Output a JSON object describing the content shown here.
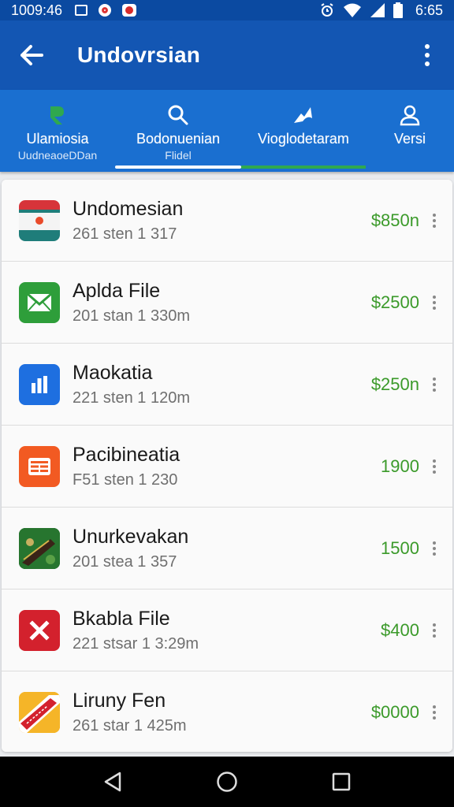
{
  "status_bar": {
    "time_left": "1009:46",
    "time_right": "6:65"
  },
  "app_bar": {
    "title": "Undovrsian"
  },
  "tabs": [
    {
      "icon": "leaf-icon",
      "label": "Ulamiosia",
      "sub": "UudneaoeDDan"
    },
    {
      "icon": "search-icon",
      "label": "Bodonuenian",
      "sub": "Flidel"
    },
    {
      "icon": "ship-icon",
      "label": "Vioglodetaram",
      "sub": ""
    },
    {
      "icon": "person-icon",
      "label": "Versi",
      "sub": ""
    }
  ],
  "items": [
    {
      "name": "Undomesian",
      "meta": "261 sten 1 317",
      "price": "$850n",
      "icon": "flag-icon"
    },
    {
      "name": "Aplda File",
      "meta": "201 stan 1 330m",
      "price": "$2500",
      "icon": "mail-icon"
    },
    {
      "name": "Maokatia",
      "meta": "221 sten 1 120m",
      "price": "$250n",
      "icon": "chart-icon"
    },
    {
      "name": "Pacibineatia",
      "meta": "F51 sten 1 230",
      "price": "1900",
      "icon": "table-icon"
    },
    {
      "name": "Unurkevakan",
      "meta": "201 stea 1 357",
      "price": "1500",
      "icon": "photo-icon"
    },
    {
      "name": "Bkabla File",
      "meta": "221 stsar 1 3:29m",
      "price": "$400",
      "icon": "close-icon"
    },
    {
      "name": "Liruny Fen",
      "meta": "261 star 1 425m",
      "price": "$0000",
      "icon": "tag-icon"
    }
  ],
  "colors": {
    "app_bar": "#1356b3",
    "tab_bar": "#1a6fd0",
    "price_green": "#3b9a2a"
  }
}
